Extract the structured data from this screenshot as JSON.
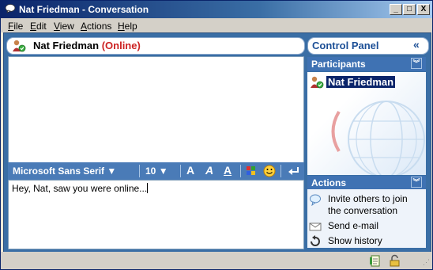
{
  "window": {
    "title": "Nat Friedman - Conversation"
  },
  "titlebar": {
    "minimize": "_",
    "maximize": "□",
    "close": "X"
  },
  "menubar": {
    "items": [
      {
        "label": "File",
        "accel": "F",
        "rest": "ile"
      },
      {
        "label": "Edit",
        "accel": "E",
        "rest": "dit"
      },
      {
        "label": "View",
        "accel": "V",
        "rest": "iew"
      },
      {
        "label": "Actions",
        "accel": "A",
        "rest": "ctions"
      },
      {
        "label": "Help",
        "accel": "H",
        "rest": "elp"
      }
    ]
  },
  "conversation": {
    "contact_name": "Nat Friedman",
    "contact_status": "(Online)",
    "input_text": "Hey, Nat, saw you were online..."
  },
  "format_toolbar": {
    "font": "Microsoft Sans Serif",
    "size": "10",
    "bold": "A",
    "italic": "A",
    "underline": "A"
  },
  "control_panel": {
    "title": "Control Panel",
    "participants_label": "Participants",
    "participants": [
      "Nat Friedman"
    ],
    "actions_label": "Actions",
    "actions": [
      {
        "line1": "Invite others to join",
        "line2": "the conversation",
        "icon": "invite-icon"
      },
      {
        "line1": "Send e-mail",
        "line2": "",
        "icon": "email-icon"
      },
      {
        "line1": "Show history",
        "line2": "",
        "icon": "history-icon"
      }
    ]
  },
  "colors": {
    "accent": "#3a6ea5",
    "status_online": "#cc2222",
    "selection": "#0a246a"
  }
}
